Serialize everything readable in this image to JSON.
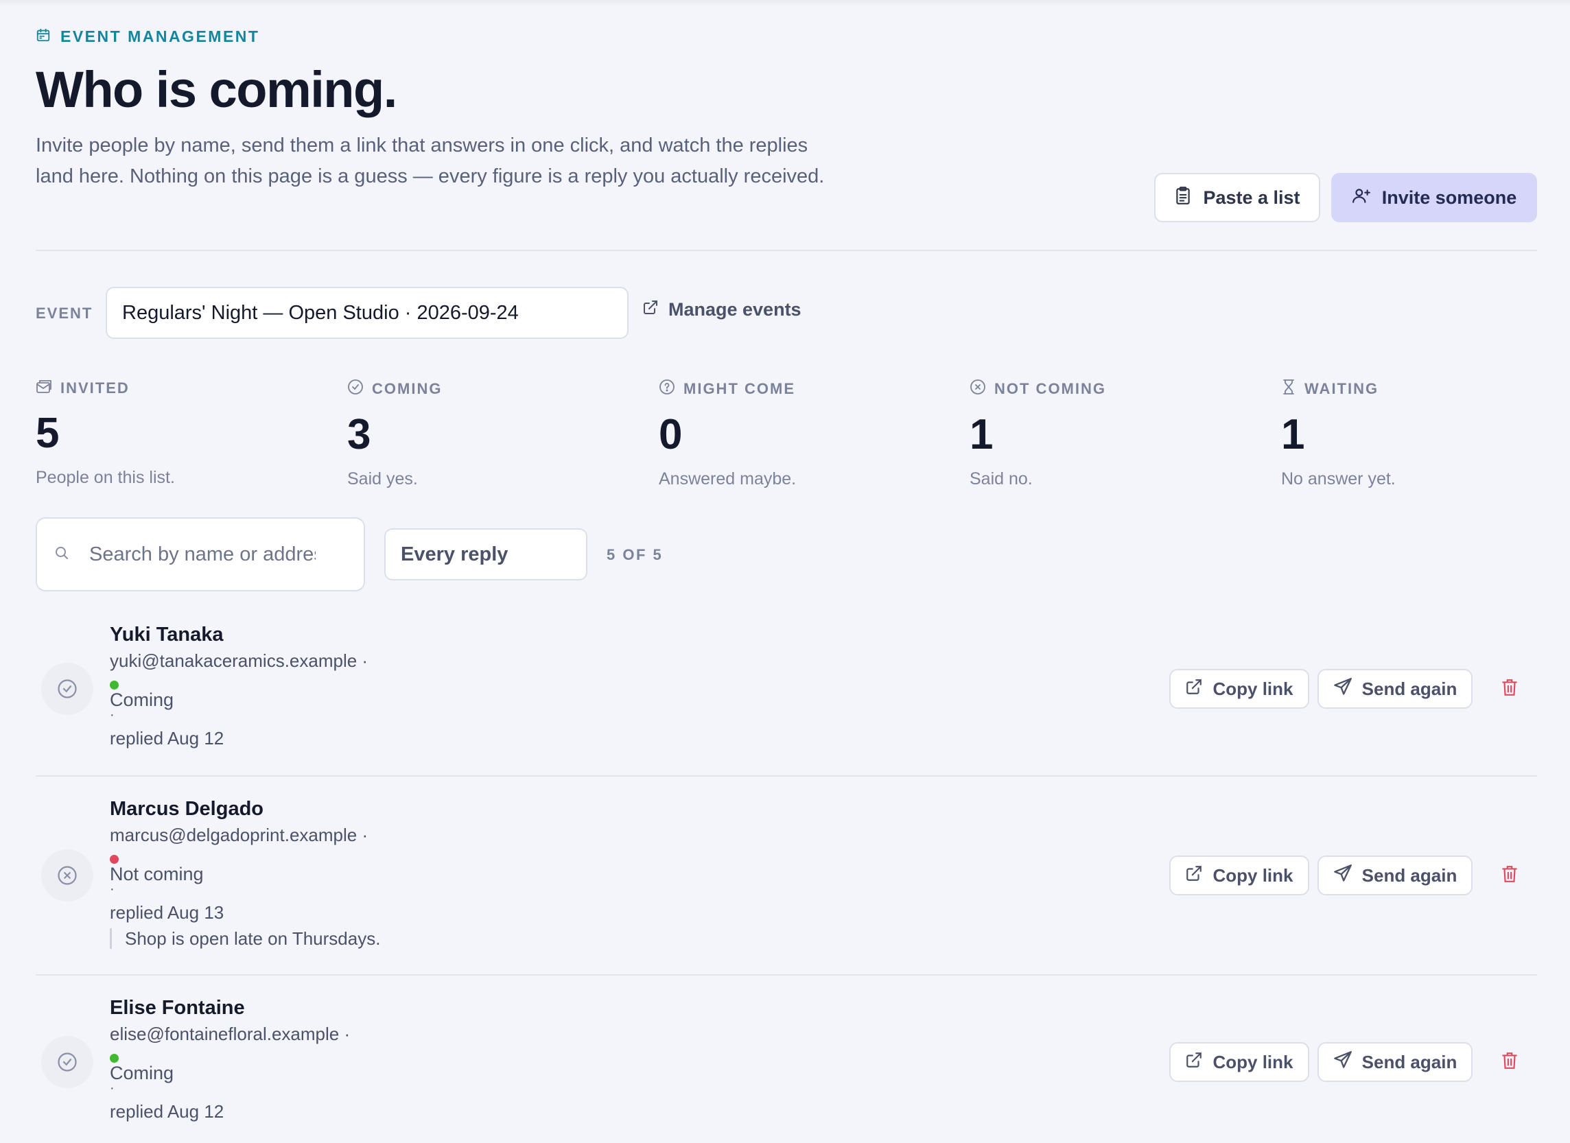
{
  "header": {
    "eyebrow": "EVENT MANAGEMENT",
    "title": "Who is coming.",
    "lede": "Invite people by name, send them a link that answers in one click, and watch the replies land here. Nothing on this page is a guess — every figure is a reply you actually received.",
    "paste_label": "Paste a list",
    "invite_label": "Invite someone"
  },
  "event": {
    "label": "EVENT",
    "selected": "Regulars' Night — Open Studio · 2026-09-24",
    "manage_label": "Manage events"
  },
  "stats": [
    {
      "label": "INVITED",
      "value": "5",
      "caption": "People on this list.",
      "icon": "envelope-icon"
    },
    {
      "label": "COMING",
      "value": "3",
      "caption": "Said yes.",
      "icon": "check-circle-icon"
    },
    {
      "label": "MIGHT COME",
      "value": "0",
      "caption": "Answered maybe.",
      "icon": "question-circle-icon"
    },
    {
      "label": "NOT COMING",
      "value": "1",
      "caption": "Said no.",
      "icon": "x-circle-icon"
    },
    {
      "label": "WAITING",
      "value": "1",
      "caption": "No answer yet.",
      "icon": "hourglass-icon"
    }
  ],
  "filters": {
    "search_placeholder": "Search by name or address",
    "reply_filter": "Every reply",
    "count": "5 OF 5"
  },
  "actions": {
    "copy_label": "Copy link",
    "send_label": "Send again"
  },
  "guests": [
    {
      "name": "Yuki Tanaka",
      "email": "yuki@tanakaceramics.example ·",
      "status": "Coming",
      "status_color": "#3dbb2c",
      "sep": "·",
      "replied": "replied Aug 12",
      "note": ""
    },
    {
      "name": "Marcus Delgado",
      "email": "marcus@delgadoprint.example ·",
      "status": "Not coming",
      "status_color": "#e0485e",
      "sep": "·",
      "replied": "replied Aug 13",
      "note": "Shop is open late on Thursdays."
    },
    {
      "name": "Elise Fontaine",
      "email": "elise@fontainefloral.example ·",
      "status": "Coming",
      "status_color": "#3dbb2c",
      "sep": "·",
      "replied": "replied Aug 12",
      "note": ""
    }
  ],
  "colors": {
    "accent_teal": "#12869c",
    "primary_button": "#d6d6fb",
    "danger": "#e0485e",
    "success": "#3dbb2c"
  }
}
